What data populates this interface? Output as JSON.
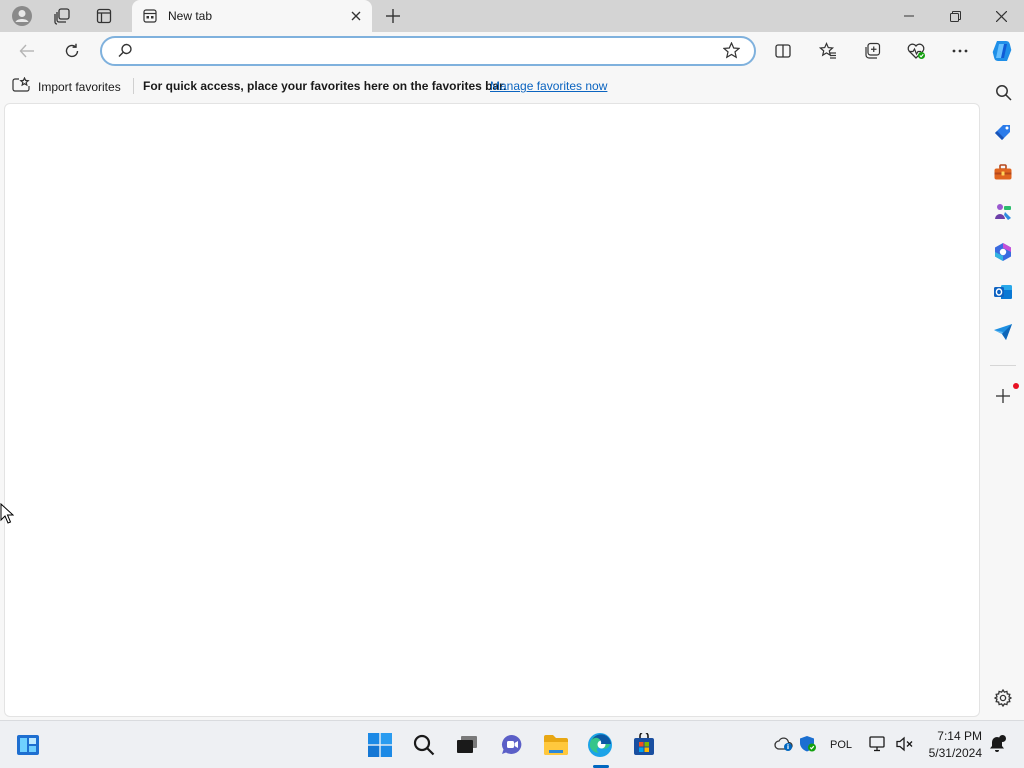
{
  "tab": {
    "title": "New tab"
  },
  "address": {
    "value": "",
    "placeholder": ""
  },
  "favorites_bar": {
    "import_label": "Import favorites",
    "message": "For quick access, place your favorites here on the favorites bar.",
    "manage_link": "Manage favorites now"
  },
  "taskbar": {
    "language": "POL",
    "time": "7:14 PM",
    "date": "5/31/2024"
  },
  "colors": {
    "accent": "#0067c0",
    "link": "#0b64c0",
    "address_border": "#7fb1dd",
    "notification_dot": "#e81123"
  },
  "icons": {
    "titlebar": [
      "profile-icon",
      "workspaces-icon",
      "tab-actions-icon"
    ],
    "toolbar": [
      "back-icon",
      "refresh-icon",
      "split-screen-icon",
      "favorites-icon",
      "collections-icon",
      "browser-essentials-icon",
      "more-icon",
      "copilot-icon"
    ],
    "sidebar": [
      "search-icon",
      "shopping-icon",
      "tools-icon",
      "games-icon",
      "microsoft365-icon",
      "outlook-icon",
      "drop-icon",
      "add-icon",
      "settings-icon"
    ],
    "taskbar": [
      "widgets-icon",
      "start-icon",
      "search-icon",
      "task-view-icon",
      "chat-icon",
      "file-explorer-icon",
      "edge-icon",
      "store-icon"
    ]
  }
}
